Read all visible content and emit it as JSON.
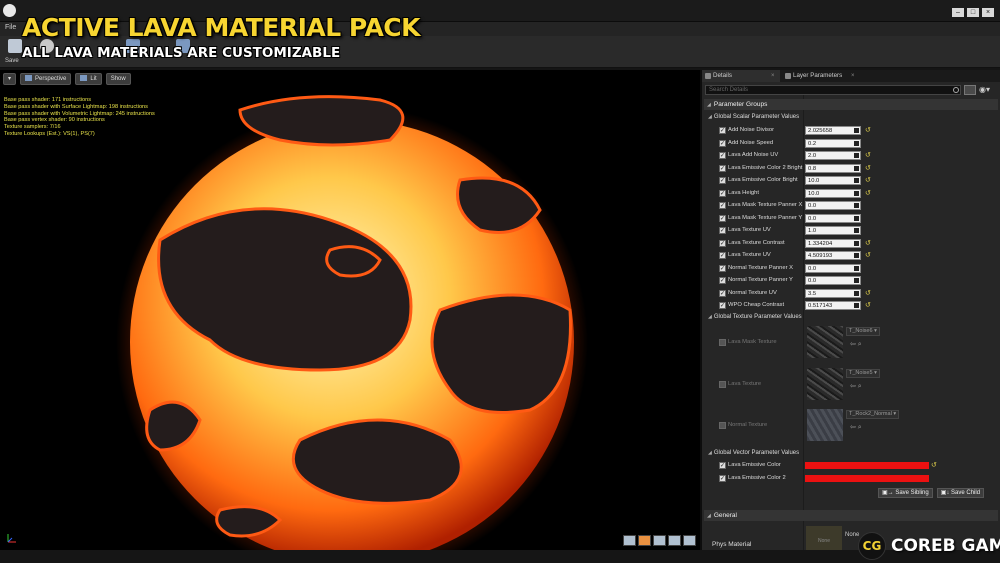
{
  "overlay": {
    "title": "ACTIVE LAVA MATERIAL PACK",
    "subtitle": "ALL LAVA MATERIALS ARE CUSTOMIZABLE"
  },
  "menu": {
    "file": "File"
  },
  "toolbar": {
    "save_label": "Save"
  },
  "viewport": {
    "perspective": "Perspective",
    "lit": "Lit",
    "show": "Show",
    "stats": [
      "Base pass shader: 171 instructions",
      "Base pass shader with Surface Lightmap: 198 instructions",
      "Base pass shader with Volumetric Lightmap: 245 instructions",
      "Base pass vertex shader: 90 instructions",
      "Texture samplers: 7/16",
      "Texture Lookups (Est.): VS(1), PS(7)"
    ]
  },
  "panel": {
    "tab_details": "Details",
    "tab_layers": "Layer Parameters",
    "search_placeholder": "Search Details",
    "parameter_groups": "Parameter Groups",
    "scalar_group": "Global Scalar Parameter Values",
    "scalars": [
      {
        "label": "Add Noise Divisor",
        "value": "2.025658",
        "reset": true
      },
      {
        "label": "Add Noise Speed",
        "value": "0.2",
        "reset": false
      },
      {
        "label": "Lava Add Noise UV",
        "value": "2.0",
        "reset": true
      },
      {
        "label": "Lava Emissive Color 2 Bright",
        "value": "0.8",
        "reset": true
      },
      {
        "label": "Lava Emissive Color Bright",
        "value": "10.0",
        "reset": true
      },
      {
        "label": "Lava Height",
        "value": "10.0",
        "reset": true
      },
      {
        "label": "Lava Mask Texture Panner X",
        "value": "0.0",
        "reset": false
      },
      {
        "label": "Lava Mask Texture Panner Y",
        "value": "0.0",
        "reset": false
      },
      {
        "label": "Lava Texture UV",
        "value": "1.0",
        "reset": false
      },
      {
        "label": "Lava Texture Contrast",
        "value": "1.334204",
        "reset": true
      },
      {
        "label": "Lava Texture UV",
        "value": "4.509193",
        "reset": true
      },
      {
        "label": "Normal Texture Panner X",
        "value": "0.0",
        "reset": false
      },
      {
        "label": "Normal Texture Panner Y",
        "value": "0.0",
        "reset": false
      },
      {
        "label": "Normal Texture UV",
        "value": "3.5",
        "reset": true
      },
      {
        "label": "WPO Cheap Contrast",
        "value": "0.517143",
        "reset": true
      }
    ],
    "texture_group": "Global Texture Parameter Values",
    "textures": [
      {
        "label": "Lava Mask Texture",
        "asset": "T_Noise6"
      },
      {
        "label": "Lava Texture",
        "asset": "T_Noise5"
      },
      {
        "label": "Normal Texture",
        "asset": "T_Rock2_Normal"
      }
    ],
    "vector_group": "Global Vector Parameter Values",
    "vectors": [
      {
        "label": "Lava Emissive Color",
        "color": "#ec1111"
      },
      {
        "label": "Lava Emissive Color 2",
        "color": "#ec1111"
      }
    ],
    "save_sibling": "Save Sibling",
    "save_child": "Save Child",
    "general": "General",
    "phys_material": "Phys Material",
    "phys_thumb": "None",
    "phys_value": "None"
  },
  "watermark": {
    "logo": "CG",
    "text": "COREB GAMES"
  }
}
